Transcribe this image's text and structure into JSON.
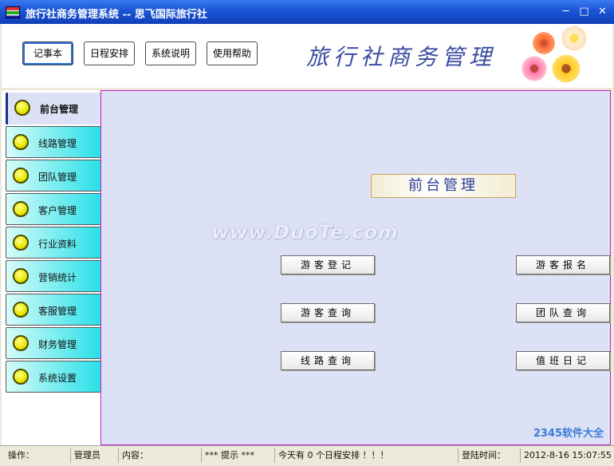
{
  "window": {
    "title": "旅行社商务管理系统 -- 思飞国际旅行社"
  },
  "toolbar": {
    "buttons": [
      "记事本",
      "日程安排",
      "系统说明",
      "使用帮助"
    ],
    "banner": "旅行社商务管理"
  },
  "sidebar": {
    "items": [
      "前台管理",
      "线路管理",
      "团队管理",
      "客户管理",
      "行业资料",
      "营销统计",
      "客服管理",
      "财务管理",
      "系统设置"
    ],
    "selected": "前台管理"
  },
  "main": {
    "section_title": "前台管理",
    "watermark": "www.DuoTe.com",
    "left_buttons": [
      "游客登记",
      "游客查询",
      "线路查询"
    ],
    "right_buttons": [
      "游客报名",
      "团队查询",
      "值班日记"
    ],
    "corner_logo": "2345软件大全"
  },
  "status": {
    "op_label": "操作：",
    "user": "管理员",
    "content_label": "内容：",
    "tip": "*** 提示 ***",
    "message": "今天有 0 个日程安排 ！！！",
    "login_label": "登陆时间：",
    "login_time": "2012-8-16 15:07:55"
  },
  "colors": {
    "accent": "#1d56d8",
    "nav_cyan": "#28e0e8",
    "main_bg": "#dde1f5"
  }
}
